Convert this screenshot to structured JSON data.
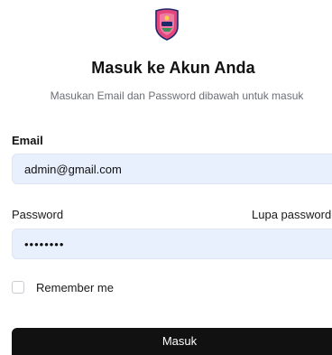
{
  "header": {
    "logo_icon": "crest-shield-icon",
    "title": "Masuk ke Akun Anda",
    "subtitle": "Masukan Email dan Password dibawah untuk masuk"
  },
  "form": {
    "email_label": "Email",
    "email_value": "admin@gmail.com",
    "password_label": "Password",
    "forgot_label": "Lupa password",
    "password_value": "••••••••",
    "remember_label": "Remember me",
    "remember_checked": false,
    "submit_label": "Masuk"
  },
  "colors": {
    "input_bg": "#e8effd",
    "button_bg": "#111111",
    "logo_pink": "#e2467c",
    "logo_navy": "#1f2a6b"
  }
}
